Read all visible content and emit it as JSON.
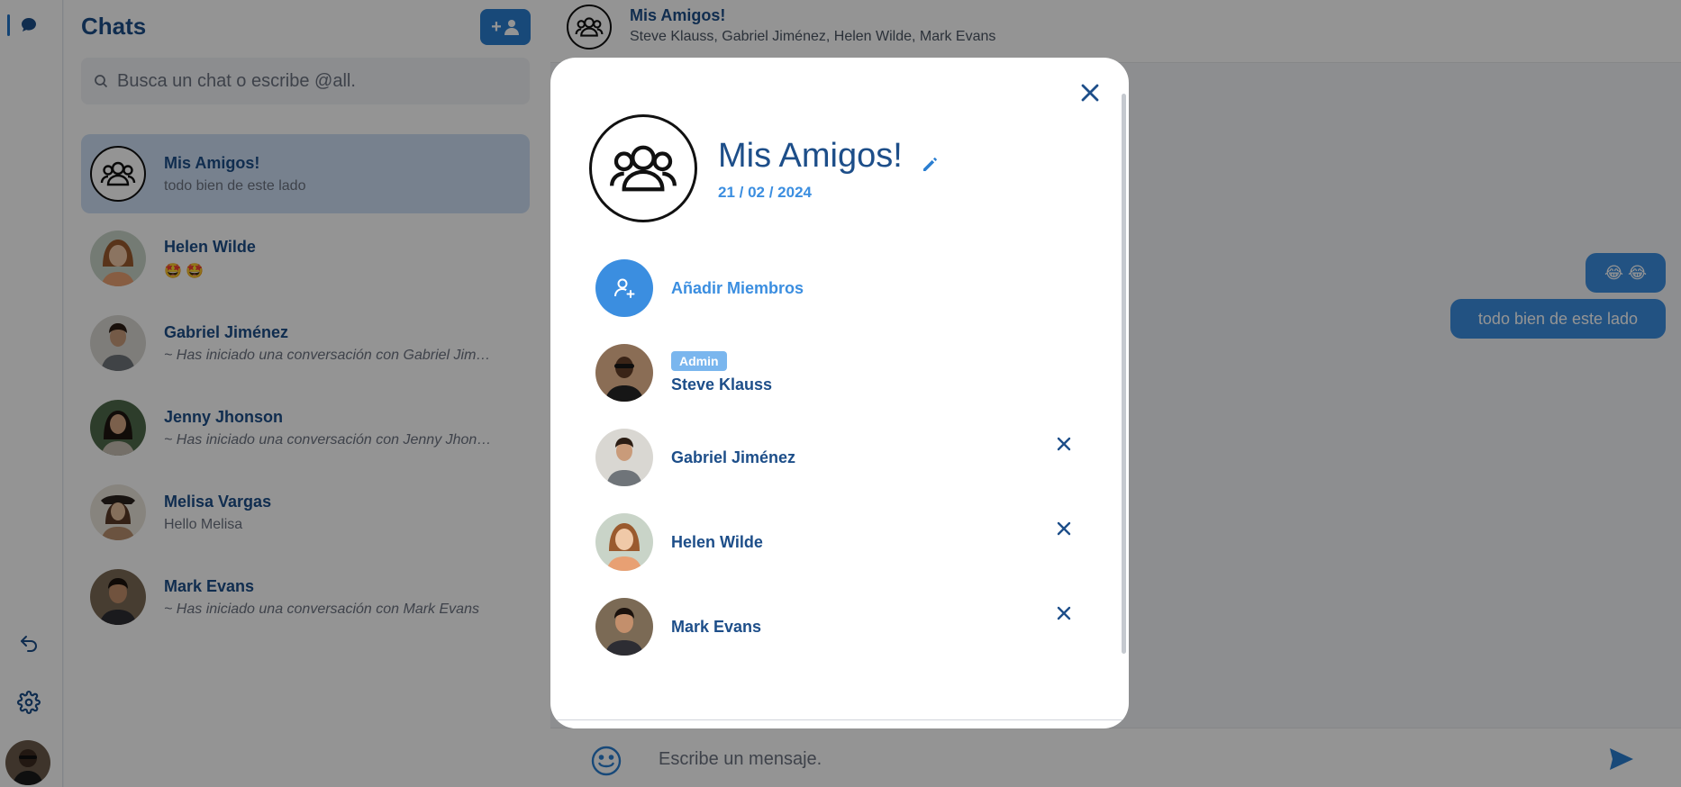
{
  "sidebar": {
    "rail_icons": [
      "chat-bubble-icon",
      "logout-arrow-icon",
      "gear-icon"
    ]
  },
  "chatlist": {
    "title": "Chats",
    "new_chat_label": "+",
    "search_placeholder": "Busca un chat o escribe @all.",
    "items": [
      {
        "name": "Mis Amigos!",
        "preview": "todo bien de este lado",
        "avatar": "group",
        "active": true
      },
      {
        "name": "Helen Wilde",
        "preview": "🤩 🤩",
        "avatar": "helen"
      },
      {
        "name": "Gabriel Jiménez",
        "preview": "~ Has iniciado una conversación con Gabriel Jiménez",
        "avatar": "gabriel"
      },
      {
        "name": "Jenny Jhonson",
        "preview": "~ Has iniciado una conversación con Jenny Jhonson",
        "avatar": "jenny"
      },
      {
        "name": "Melisa Vargas",
        "preview": "Hello Melisa",
        "avatar": "melisa"
      },
      {
        "name": "Mark Evans",
        "preview": "~ Has iniciado una conversación con Mark Evans",
        "avatar": "mark"
      }
    ]
  },
  "conversation": {
    "title": "Mis Amigos!",
    "members": "Steve Klauss, Gabriel Jiménez, Helen Wilde, Mark Evans",
    "messages": [
      {
        "text": "😂 😂"
      },
      {
        "text": "todo bien de este lado"
      }
    ],
    "composer_placeholder": "Escribe un mensaje."
  },
  "modal": {
    "group_name": "Mis Amigos!",
    "created_date": "21 / 02 / 2024",
    "add_members_label": "Añadir Miembros",
    "admin_badge": "Admin",
    "members": [
      {
        "name": "Steve Klauss",
        "avatar": "steve",
        "admin": true
      },
      {
        "name": "Gabriel Jiménez",
        "avatar": "gabriel"
      },
      {
        "name": "Helen Wilde",
        "avatar": "helen"
      },
      {
        "name": "Mark Evans",
        "avatar": "mark"
      }
    ]
  },
  "colors": {
    "accent": "#3b8ee0",
    "primary_dark": "#1d4e89",
    "active_chat_bg": "#cddff5"
  }
}
